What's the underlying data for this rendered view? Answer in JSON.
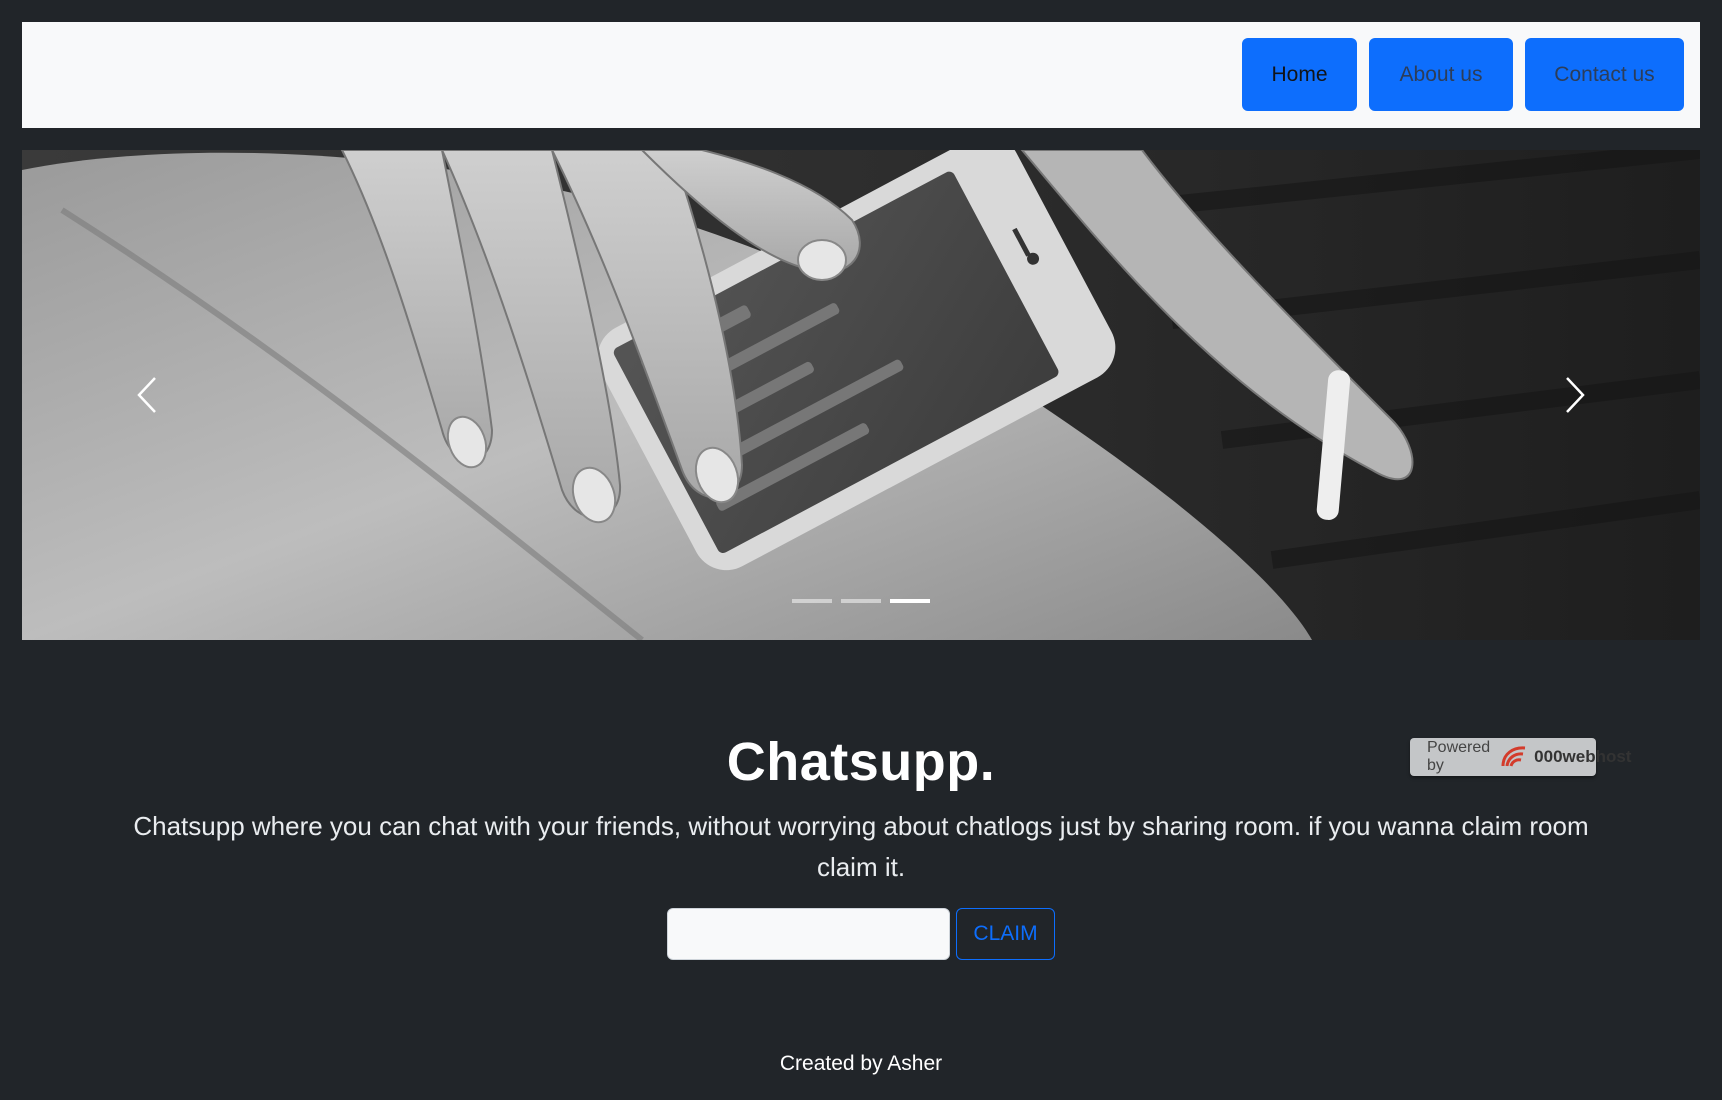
{
  "nav": {
    "items": [
      {
        "label": "Home"
      },
      {
        "label": "About us"
      },
      {
        "label": "Contact us"
      }
    ],
    "accent": "#0d6efd"
  },
  "carousel": {
    "slide_count": 3,
    "active_index": 2,
    "prev_icon": "chevron-left-icon",
    "next_icon": "chevron-right-icon"
  },
  "hero": {
    "title": "Chatsupp.",
    "description": "Chatsupp where you can chat with your friends, without worrying about chatlogs just by sharing room. if you wanna claim room claim it."
  },
  "claim": {
    "input_value": "",
    "button_label": "CLAIM"
  },
  "footer": {
    "text": "Created by Asher"
  },
  "badge": {
    "prefix": "Powered by",
    "brand": "000webhost",
    "icon": "000webhost-logo-icon"
  }
}
